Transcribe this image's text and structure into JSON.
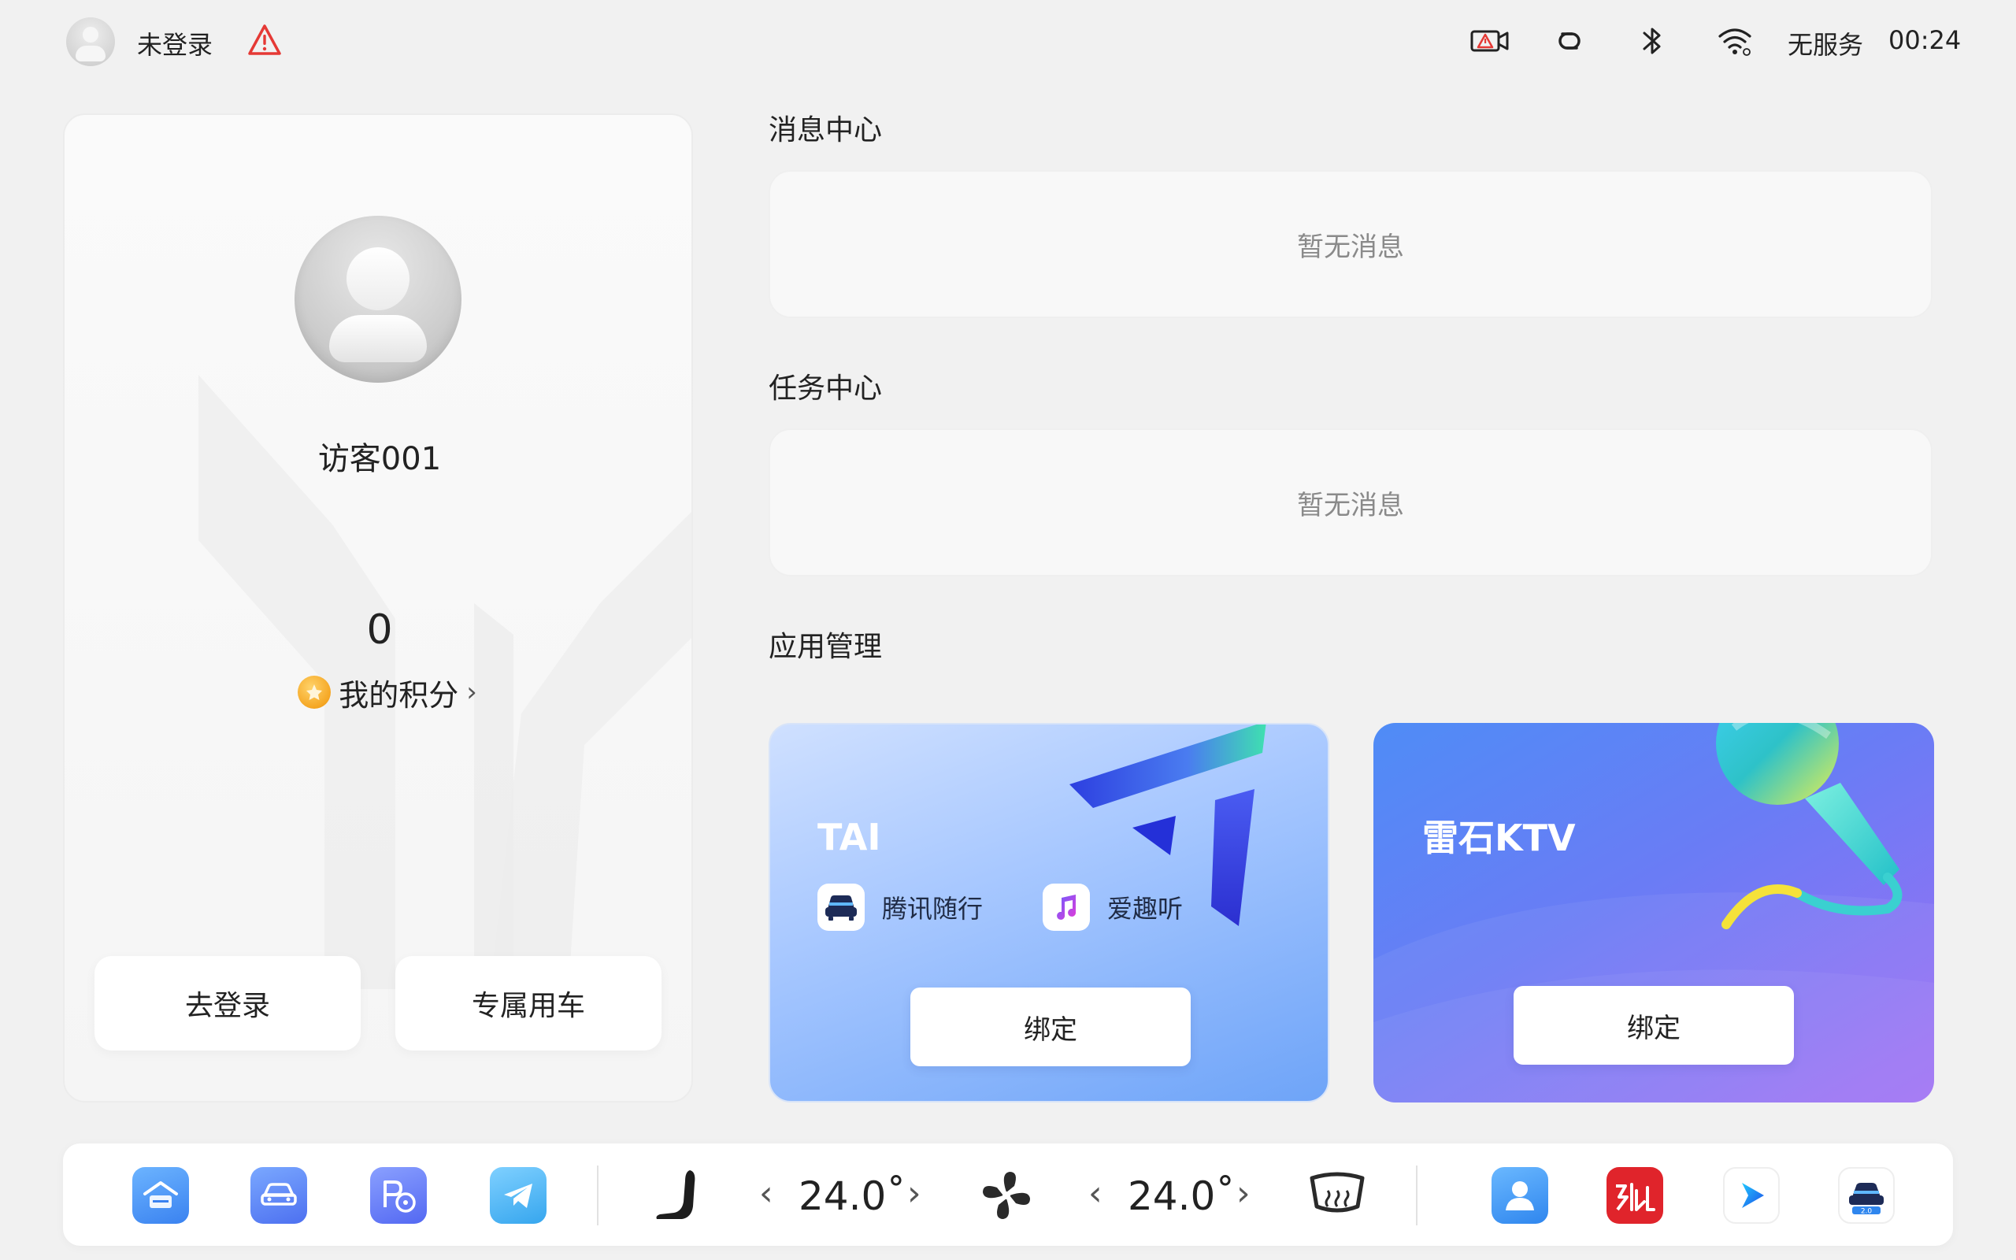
{
  "status_bar": {
    "login_status": "未登录",
    "service": "无服务",
    "time": "00:24",
    "icons": [
      "user-avatar-icon",
      "warning-triangle-icon",
      "dashcam-alert-icon",
      "hicar-link-icon",
      "bluetooth-icon",
      "wifi-icon"
    ]
  },
  "profile": {
    "name": "访客001",
    "points_value": "0",
    "points_label": "我的积分",
    "points_chevron": "›",
    "login_button": "去登录",
    "exclusive_car_button": "专属用车"
  },
  "message_center": {
    "title": "消息中心",
    "empty_text": "暂无消息"
  },
  "task_center": {
    "title": "任务中心",
    "empty_text": "暂无消息"
  },
  "app_management": {
    "title": "应用管理",
    "cards": [
      {
        "title": "TAI",
        "services": [
          {
            "label": "腾讯随行",
            "icon": "car-front-icon"
          },
          {
            "label": "爱趣听",
            "icon": "music-note-icon"
          }
        ],
        "bind_label": "绑定"
      },
      {
        "title": "雷石KTV",
        "bind_label": "绑定"
      }
    ]
  },
  "dock": {
    "left_apps": [
      "home-app-icon",
      "vehicle-app-icon",
      "parking-app-icon",
      "telegram-app-icon"
    ],
    "driver_temp": "24.0˚",
    "passenger_temp": "24.0˚",
    "temp_left_arrow": "‹",
    "temp_right_arrow": "›",
    "right_apps": [
      "contacts-app-icon",
      "iqiyi-app-icon",
      "video-player-app-icon",
      "car-assistant-app-icon"
    ]
  },
  "colors": {
    "background": "#f1f1f1",
    "warning_red": "#e53935",
    "tai_card": "#8db6fb",
    "ktv_card": "#6f7cf5",
    "coin": "#f5a623"
  }
}
